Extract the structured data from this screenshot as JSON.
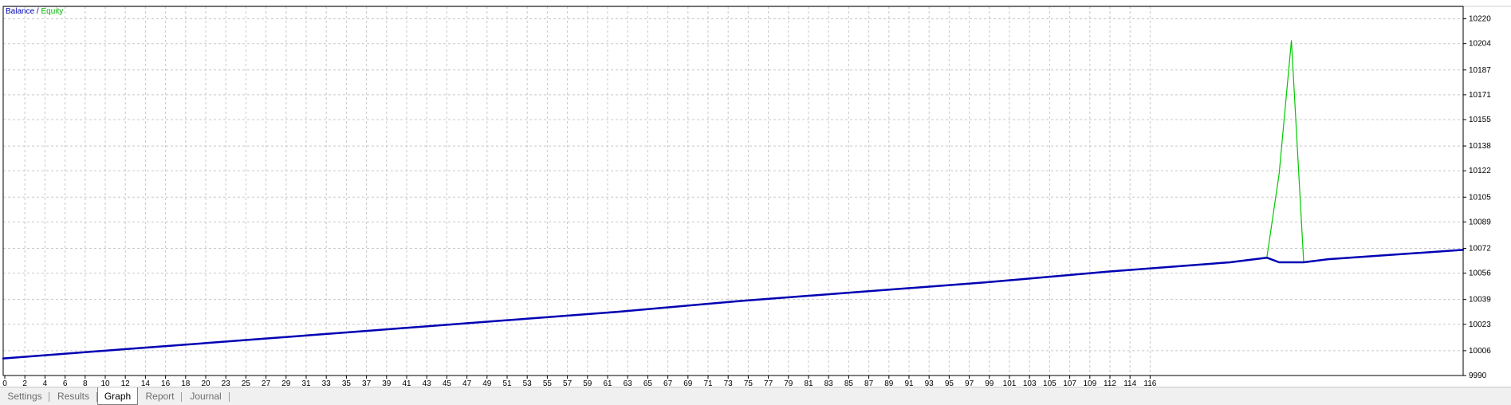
{
  "legend": {
    "balance": "Balance",
    "separator": " / ",
    "equity": "Equity"
  },
  "colors": {
    "balance": "#0000b4",
    "equity": "#00c800",
    "grid": "#c8c8c8",
    "background": "#ffffff"
  },
  "tabs": [
    {
      "label": "Settings",
      "active": false
    },
    {
      "label": "Results",
      "active": false
    },
    {
      "label": "Graph",
      "active": true
    },
    {
      "label": "Report",
      "active": false
    },
    {
      "label": "Journal",
      "active": false
    }
  ],
  "chart_data": {
    "type": "line",
    "grid": true,
    "legend": "top-left",
    "xlim": [
      0,
      119
    ],
    "ylim": [
      9990,
      10228
    ],
    "x_ticks": [
      "0",
      "2",
      "4",
      "6",
      "8",
      "10",
      "12",
      "14",
      "16",
      "18",
      "20",
      "23",
      "25",
      "27",
      "29",
      "31",
      "33",
      "35",
      "37",
      "39",
      "41",
      "43",
      "45",
      "47",
      "49",
      "51",
      "53",
      "55",
      "57",
      "59",
      "61",
      "63",
      "65",
      "67",
      "69",
      "71",
      "73",
      "75",
      "77",
      "79",
      "81",
      "83",
      "85",
      "87",
      "89",
      "91",
      "93",
      "95",
      "97",
      "99",
      "101",
      "103",
      "105",
      "107",
      "109",
      "112",
      "114",
      "116"
    ],
    "y_ticks": [
      9990,
      10006,
      10023,
      10039,
      10056,
      10072,
      10089,
      10105,
      10122,
      10138,
      10155,
      10171,
      10187,
      10204,
      10220
    ],
    "series": [
      {
        "name": "Balance",
        "x": [
          0,
          10,
          20,
          30,
          40,
          50,
          60,
          70,
          80,
          90,
          100,
          103,
          104,
          106,
          108,
          119
        ],
        "y": [
          10001,
          10007,
          10013,
          10019,
          10025,
          10031,
          10038,
          10044,
          10050,
          10057,
          10063,
          10066,
          10063,
          10063,
          10065,
          10071
        ]
      },
      {
        "name": "Equity",
        "x": [
          0,
          10,
          20,
          30,
          40,
          50,
          60,
          70,
          80,
          90,
          100,
          103,
          104,
          105,
          106,
          108,
          119
        ],
        "y": [
          10001,
          10007,
          10013,
          10019,
          10025,
          10031,
          10038,
          10044,
          10050,
          10057,
          10063,
          10066,
          10120,
          10206,
          10063,
          10065,
          10071
        ]
      }
    ]
  }
}
